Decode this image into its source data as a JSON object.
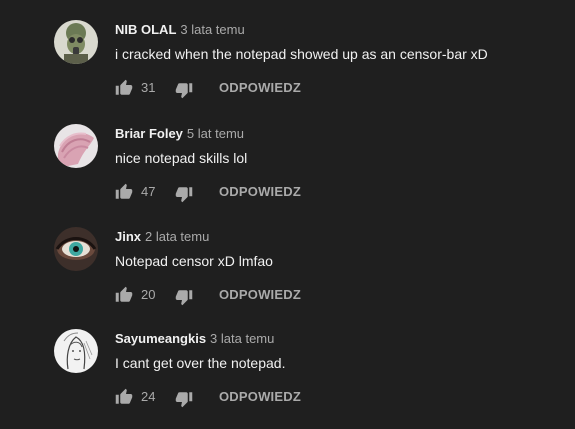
{
  "colors": {
    "background": "#1f1f1f",
    "text_primary": "#f1f1f1",
    "text_secondary": "#aaaaaa"
  },
  "comments": [
    {
      "author": "NIB OLAL",
      "time": "3 lata temu",
      "text": "i cracked when the notepad showed up as an censor-bar xD",
      "likes": "31",
      "reply_label": "ODPOWIEDZ",
      "avatar_icon": "gas-mask-avatar"
    },
    {
      "author": "Briar Foley",
      "time": "5 lat temu",
      "text": "nice notepad skills lol",
      "likes": "47",
      "reply_label": "ODPOWIEDZ",
      "avatar_icon": "pink-hair-avatar"
    },
    {
      "author": "Jinx",
      "time": "2 lata temu",
      "text": "Notepad censor xD lmfao",
      "likes": "20",
      "reply_label": "ODPOWIEDZ",
      "avatar_icon": "eye-avatar"
    },
    {
      "author": "Sayumeangkis",
      "time": "3 lata temu",
      "text": "I cant get over the notepad.",
      "likes": "24",
      "reply_label": "ODPOWIEDZ",
      "avatar_icon": "sketch-portrait-avatar"
    }
  ]
}
